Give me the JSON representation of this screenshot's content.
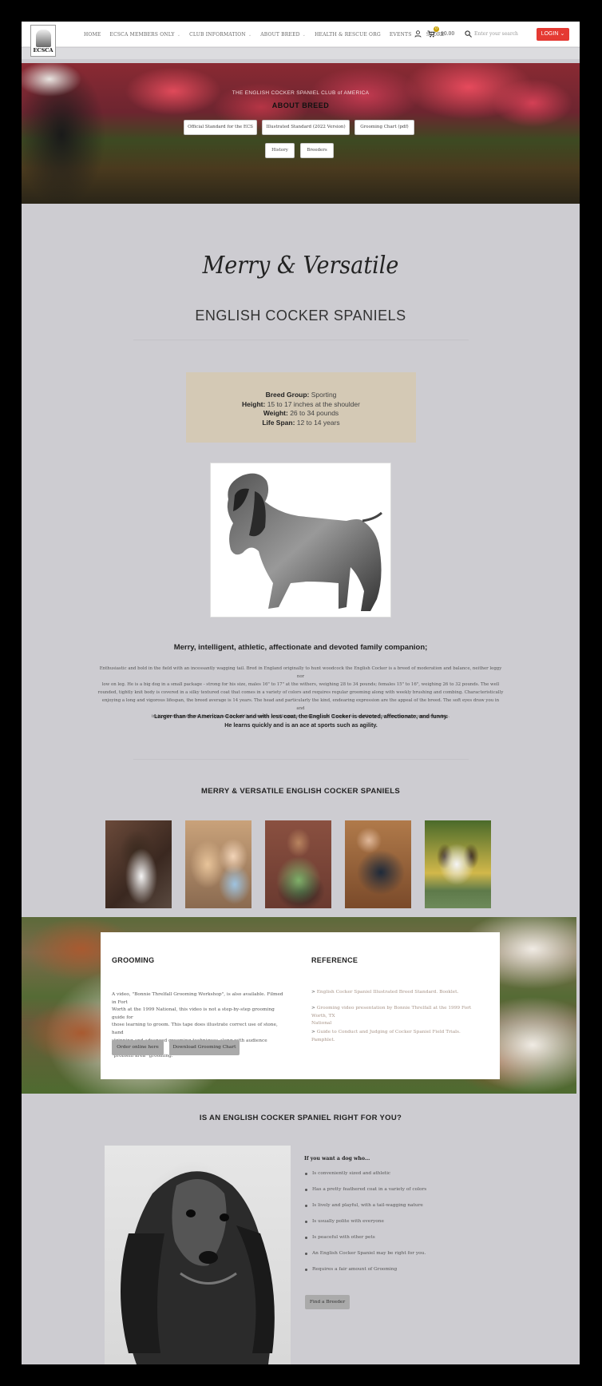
{
  "header": {
    "logo_text": "ECSCA",
    "nav": [
      {
        "label": "HOME",
        "caret": false
      },
      {
        "label": "ECSCA MEMBERS ONLY",
        "caret": true
      },
      {
        "label": "CLUB INFORMATION",
        "caret": true
      },
      {
        "label": "ABOUT BREED",
        "caret": true
      },
      {
        "label": "HEALTH & RESCUE ORG",
        "caret": false
      },
      {
        "label": "EVENTS",
        "caret": true
      },
      {
        "label": "STORE",
        "caret": false
      }
    ],
    "cart_count": "0",
    "cart_total": "$0.00",
    "search_placeholder": "Enter your search",
    "login_label": "LOGIN",
    "login_caret": "⌄",
    "icons": {
      "user": "user-icon",
      "cart": "cart-icon",
      "search": "search-icon"
    }
  },
  "hero": {
    "subtitle": "THE ENGLISH COCKER SPANIEL CLUB of AMERICA",
    "title": "ABOUT BREED",
    "buttons": [
      "Official Standard for the ECS",
      "Illustrated Standard (2022 Version)",
      "Grooming Chart (pdf)",
      "History",
      "Breeders"
    ]
  },
  "intro": {
    "script_title": "Merry & Versatile",
    "title": "ENGLISH COCKER SPANIELS",
    "facts": [
      {
        "label": "Breed Group:",
        "value": "Sporting"
      },
      {
        "label": "Height:",
        "value": "15 to 17 inches at the shoulder"
      },
      {
        "label": "Weight:",
        "value": "26 to 34 pounds"
      },
      {
        "label": "Life Span:",
        "value": "12 to 14 years"
      }
    ],
    "lead": "Merry, intelligent, athletic, affectionate and devoted family companion;",
    "paragraph_lines": [
      "Enthusiastic and bold in the field with an incessantly wagging tail. Bred in England originally to hunt woodcock the English Cocker is a breed of moderation and balance, neither leggy nor",
      "low on leg. He is a big dog in a small package - strong for his size, males 16\" to 17\" at the withers, weighing 28 to 34 pounds; females 15\" to 16\", weighing 26 to 32 pounds. The well",
      "rounded, tightly knit body is covered in a silky textured coat that comes in a variety of colors and requires regular grooming along with weekly brushing and combing. Characteristically",
      "enjoying a long and vigorous lifespan, the breed average is 14 years. The head and particularly the kind, endearing expression are the appeal of the breed. The soft eyes draw you in and",
      "instinctively you know that this is a breed that exudes a willingness to please and is game for anything involving human companionship."
    ],
    "bold_lines": [
      "Larger than the American Cocker and with less coat, the English Cocker is devoted, affectionate, and funny.",
      "He learns quickly and is an ace at sports such as agility."
    ]
  },
  "gallery": {
    "title": "MERRY & VERSATILE ENGLISH COCKER SPANIELS"
  },
  "grooming": {
    "title": "GROOMING",
    "text_lines": [
      "A video, \"Bonnie Threlfall Grooming Workshop\", is also available. Filmed in Fort",
      "Worth at the 1999 National, this video is not a step-by-step grooming guide for",
      "those learning to groom. This tape does illustrate correct use of stone, hand",
      "stripping and advanced grooming techniques along with audience questions and",
      "\"problem area\" grooming."
    ],
    "buttons": [
      "Order online here",
      "Download Grooming Chart"
    ]
  },
  "reference": {
    "title": "REFERENCE",
    "items": [
      [
        "English Cocker Spaniel Illustrated Breed Standard. Booklet."
      ],
      [
        "Grooming video presentation by Bonnie Threlfall at the 1999 Fort Worth, TX",
        "National"
      ],
      [
        "Guide to Conduct and Judging of Cocker Spaniel Field Trials. Pamphlet."
      ]
    ]
  },
  "right_for_you": {
    "title": "IS AN ENGLISH COCKER SPANIEL RIGHT FOR YOU?",
    "question": "If you want a dog who...",
    "items": [
      "Is conveniently sized and athletic",
      "Has a pretty feathered coat in a variety of colors",
      "Is lively and playful, with a tail-wagging nature",
      "Is usually polite with everyone",
      "Is peaceful with other pets",
      "An English Cocker Spaniel may be right for you.",
      "Requires a fair amount of Grooming"
    ],
    "button": "Find a Breeder"
  }
}
